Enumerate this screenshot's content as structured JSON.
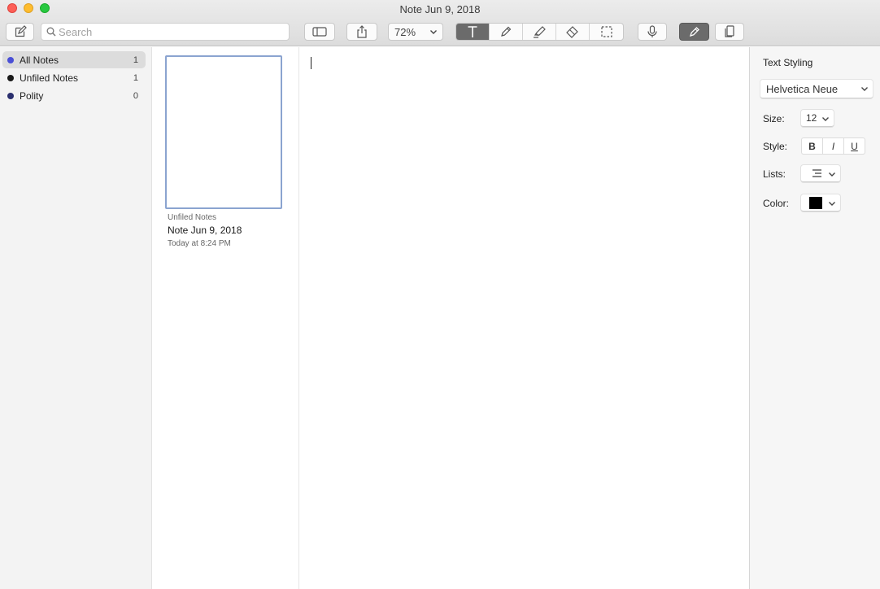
{
  "window": {
    "title": "Note Jun 9, 2018"
  },
  "toolbar": {
    "search_placeholder": "Search",
    "zoom_value": "72%"
  },
  "sidebar": {
    "items": [
      {
        "label": "All Notes",
        "count": "1",
        "dot_color": "#4a4fd6",
        "selected": true
      },
      {
        "label": "Unfiled Notes",
        "count": "1",
        "dot_color": "#1a1a1a",
        "selected": false
      },
      {
        "label": "Polity",
        "count": "0",
        "dot_color": "#2a2f6e",
        "selected": false
      }
    ]
  },
  "notelist": {
    "note": {
      "folder": "Unfiled Notes",
      "title": "Note Jun 9, 2018",
      "date": "Today at 8:24 PM"
    }
  },
  "inspector": {
    "title": "Text Styling",
    "font": "Helvetica Neue",
    "size_label": "Size:",
    "size_value": "12",
    "style_label": "Style:",
    "bold": "B",
    "italic": "I",
    "underline": "U",
    "lists_label": "Lists:",
    "color_label": "Color:",
    "color_value": "#000000"
  }
}
